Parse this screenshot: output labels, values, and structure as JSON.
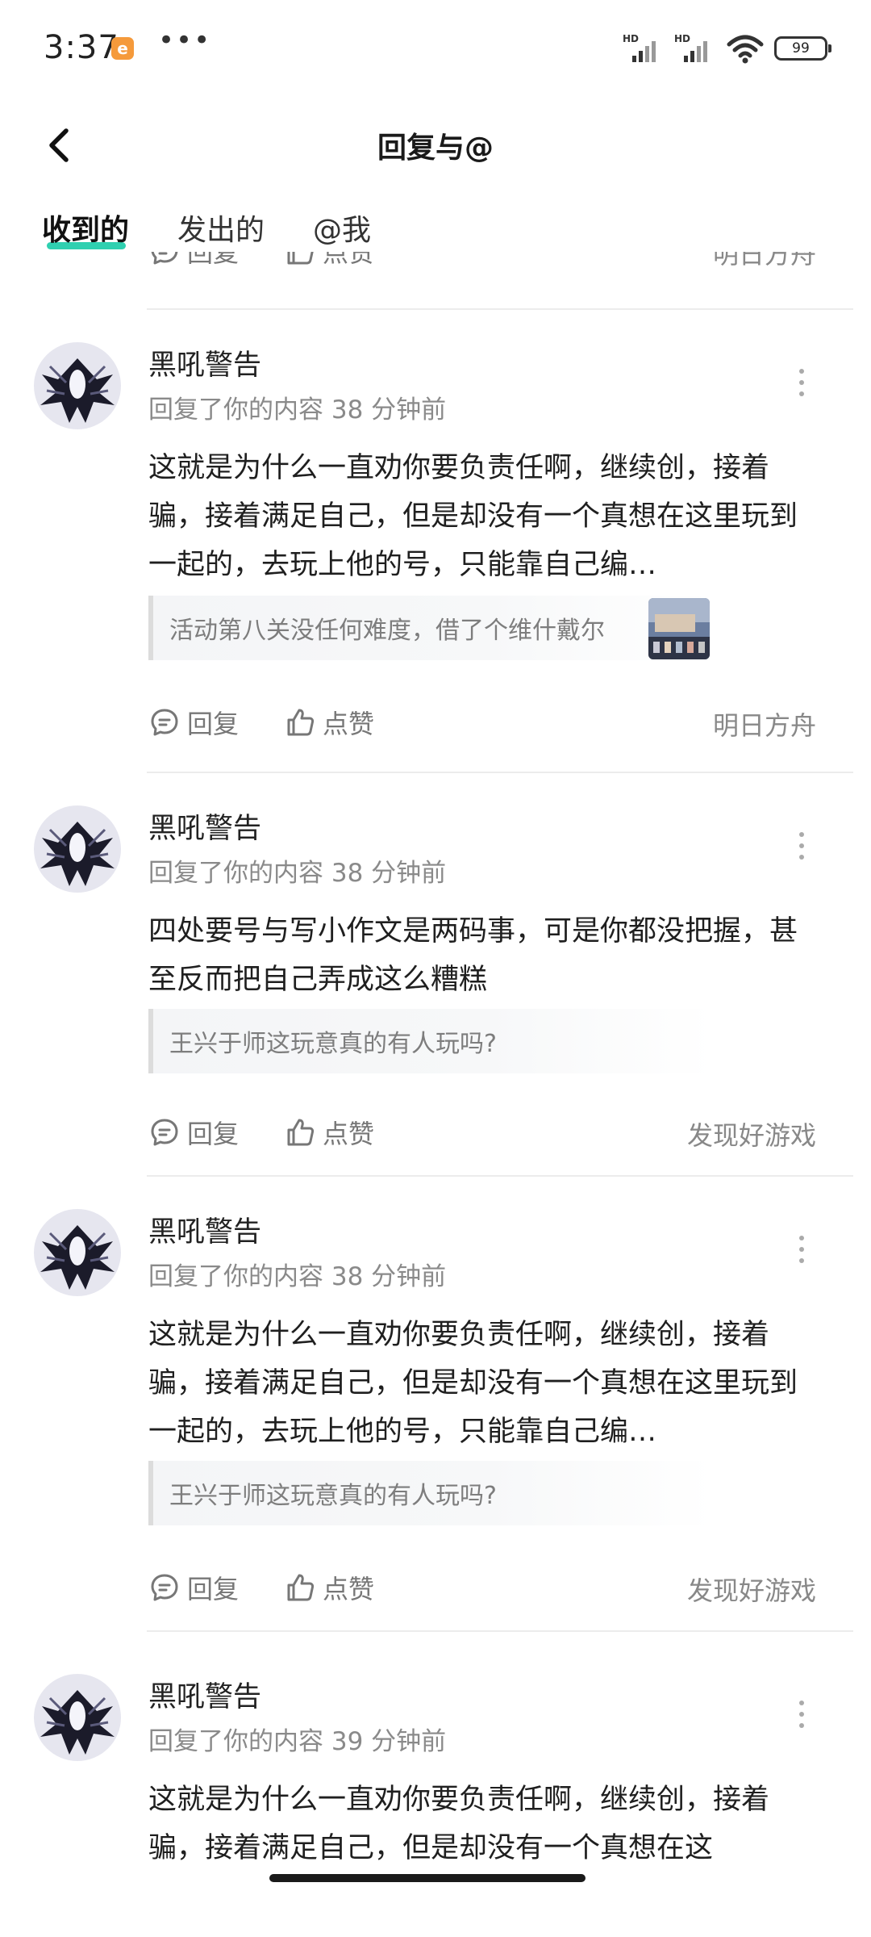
{
  "status_bar": {
    "time": "3:37",
    "app_badge": "e",
    "dots": "•••",
    "signal_label_1": "HD",
    "signal_label_2": "HD",
    "battery": "99"
  },
  "header": {
    "title": "回复与@"
  },
  "tabs": [
    {
      "label": "收到的",
      "active": true
    },
    {
      "label": "发出的",
      "active": false
    },
    {
      "label": "@我",
      "active": false
    }
  ],
  "partial_item": {
    "reply_label": "回复",
    "like_label": "点赞",
    "source": "明日方舟"
  },
  "items": [
    {
      "username": "黑吼警告",
      "meta": "回复了你的内容 38 分钟前",
      "content": "这就是为什么一直劝你要负责任啊，继续创，接着骗，接着满足自己，但是却没有一个真想在这里玩到一起的，去玩上他的号，只能靠自己编…",
      "quote": "活动第八关没任何难度，借了个维什戴尔",
      "reply_label": "回复",
      "like_label": "点赞",
      "source": "明日方舟"
    },
    {
      "username": "黑吼警告",
      "meta": "回复了你的内容 38 分钟前",
      "content": "四处要号与写小作文是两码事，可是你都没把握，甚至反而把自己弄成这么糟糕",
      "quote": "王兴于师这玩意真的有人玩吗?",
      "reply_label": "回复",
      "like_label": "点赞",
      "source": "发现好游戏"
    },
    {
      "username": "黑吼警告",
      "meta": "回复了你的内容 38 分钟前",
      "content": "这就是为什么一直劝你要负责任啊，继续创，接着骗，接着满足自己，但是却没有一个真想在这里玩到一起的，去玩上他的号，只能靠自己编…",
      "quote": "王兴于师这玩意真的有人玩吗?",
      "reply_label": "回复",
      "like_label": "点赞",
      "source": "发现好游戏"
    },
    {
      "username": "黑吼警告",
      "meta": "回复了你的内容 39 分钟前",
      "content": "这就是为什么一直劝你要负责任啊，继续创，接着骗，接着满足自己，但是却没有一个真想在这"
    }
  ],
  "colors": {
    "tab_underline": "#2fd0b0",
    "meta_text": "#8a8a8a",
    "divider": "#ececec"
  }
}
